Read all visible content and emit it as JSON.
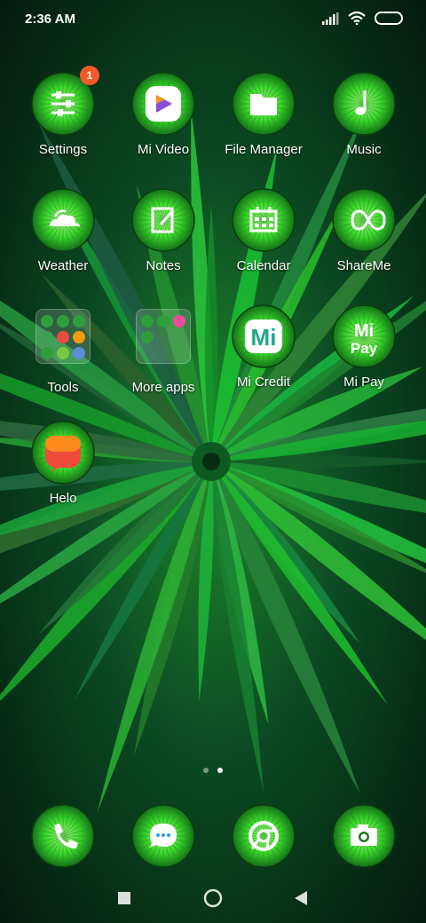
{
  "status_bar": {
    "time": "2:36 AM"
  },
  "apps": [
    {
      "id": "settings",
      "label": "Settings",
      "badge": "1"
    },
    {
      "id": "mi-video",
      "label": "Mi Video"
    },
    {
      "id": "file-manager",
      "label": "File Manager"
    },
    {
      "id": "music",
      "label": "Music"
    },
    {
      "id": "weather",
      "label": "Weather"
    },
    {
      "id": "notes",
      "label": "Notes"
    },
    {
      "id": "calendar",
      "label": "Calendar"
    },
    {
      "id": "shareme",
      "label": "ShareMe"
    },
    {
      "id": "tools",
      "label": "Tools"
    },
    {
      "id": "more-apps",
      "label": "More apps"
    },
    {
      "id": "mi-credit",
      "label": "Mi Credit",
      "icon_text": "Mi"
    },
    {
      "id": "mi-pay",
      "label": "Mi Pay",
      "icon_text": "Mi",
      "icon_subtext": "Pay"
    },
    {
      "id": "helo",
      "label": "Helo"
    }
  ],
  "dock": [
    {
      "id": "phone",
      "icon": "phone-icon"
    },
    {
      "id": "messages",
      "icon": "messages-icon"
    },
    {
      "id": "chrome",
      "icon": "chrome-icon"
    },
    {
      "id": "camera",
      "icon": "camera-icon"
    }
  ],
  "page_indicator": {
    "pages": 2,
    "current": 2
  },
  "colors": {
    "accent_green": "#39d52a",
    "badge": "#f05a28"
  }
}
